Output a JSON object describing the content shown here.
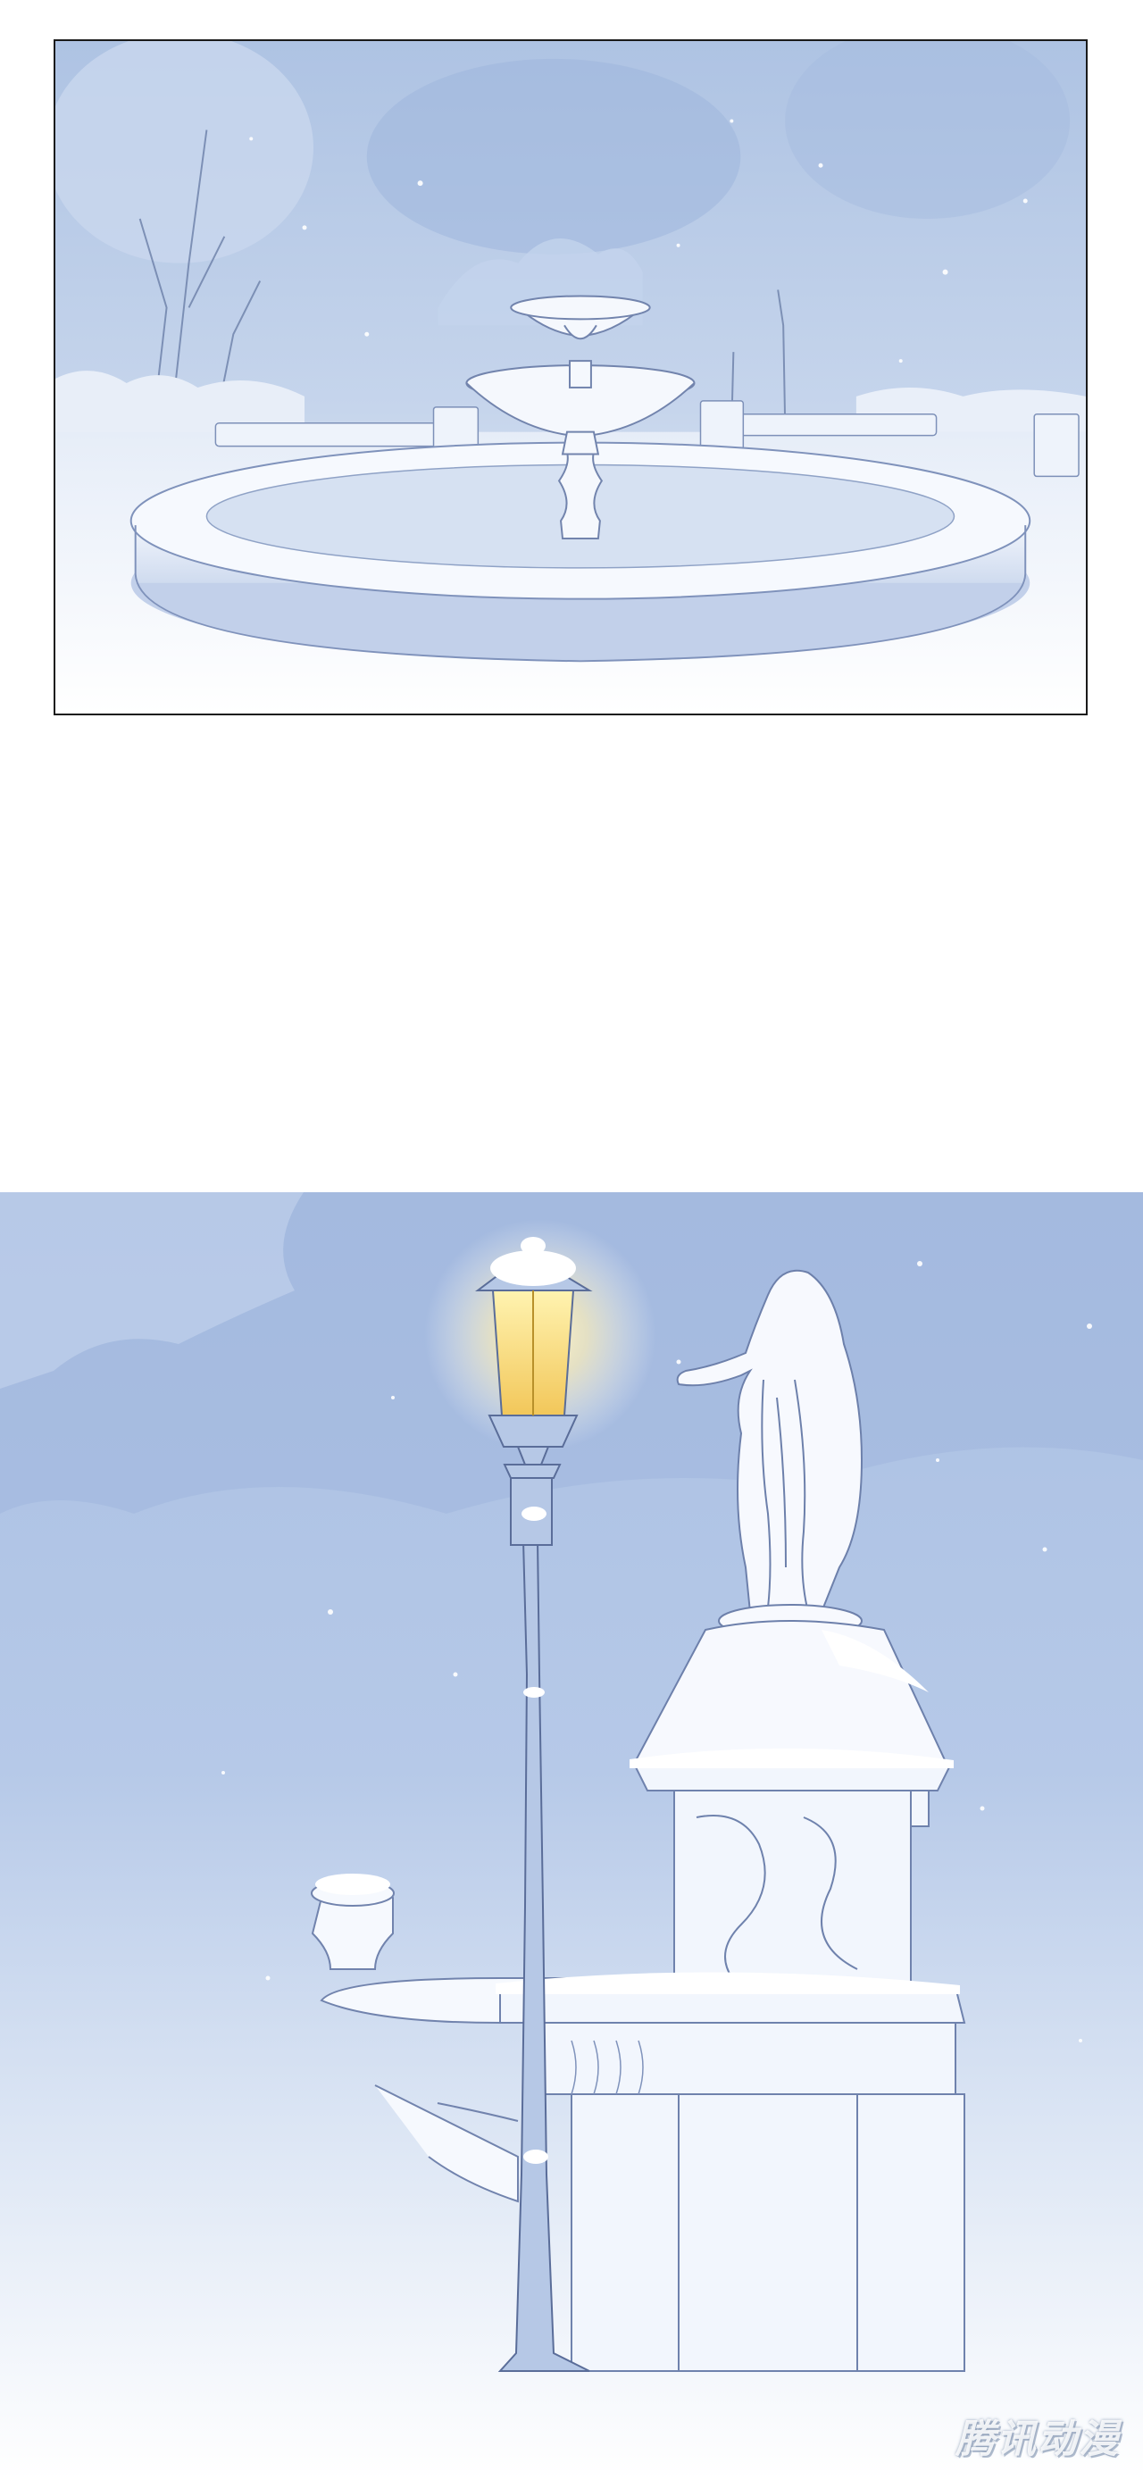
{
  "panels": [
    {
      "scene": "snow-covered-fountain"
    },
    {
      "scene": "street-lamp-and-statue"
    }
  ],
  "watermark": {
    "text": "腾讯动漫"
  },
  "colors": {
    "sky_blue": "#b9cbe6",
    "snow_white": "#f7f9fd",
    "outline": "#5c6f9a",
    "lamp_glow": "#ffe9a0"
  }
}
